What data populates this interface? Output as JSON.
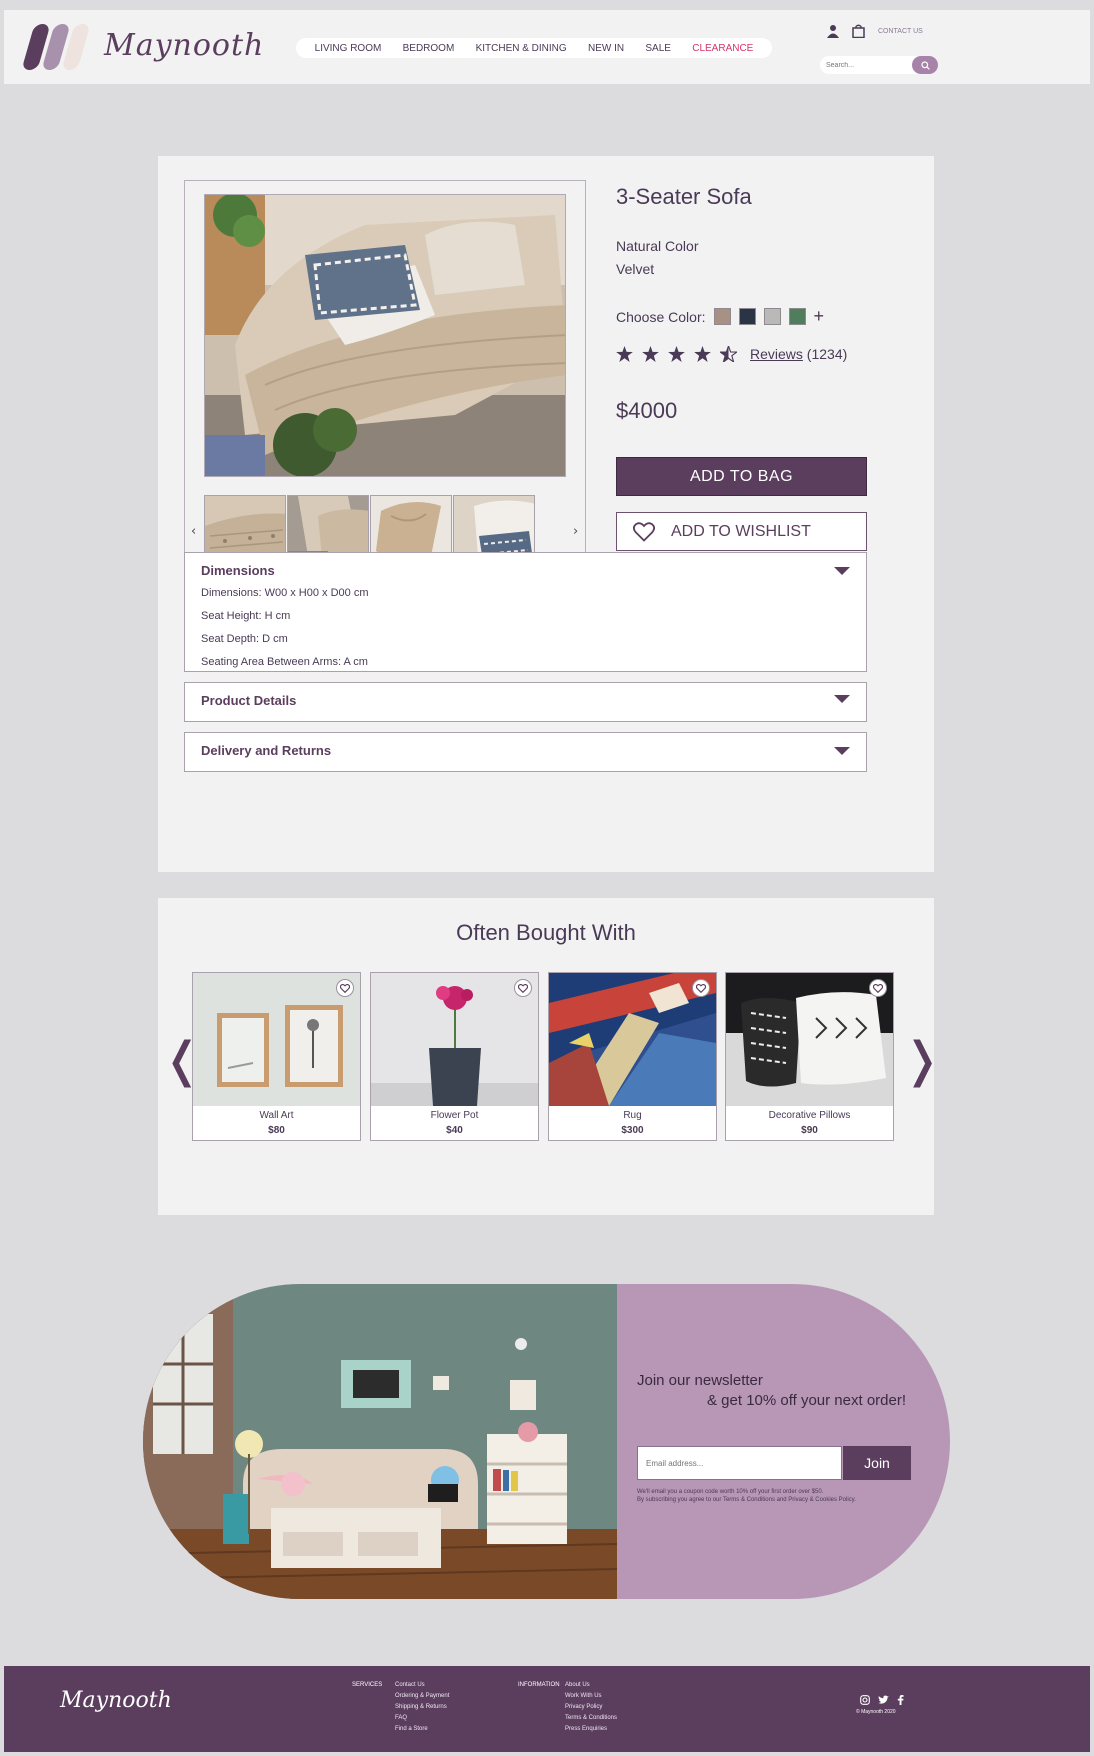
{
  "header": {
    "brand": "Maynooth",
    "nav": [
      "LIVING ROOM",
      "BEDROOM",
      "KITCHEN & DINING",
      "NEW IN",
      "SALE",
      "CLEARANCE"
    ],
    "contact": "CONTACT US",
    "search_placeholder": "Search...",
    "icons": [
      "user-icon",
      "bag-icon",
      "search-icon"
    ]
  },
  "product": {
    "title": "3-Seater Sofa",
    "color_name": "Natural Color",
    "material": "Velvet",
    "choose_color_label": "Choose Color:",
    "swatches": [
      "#a89184",
      "#2b3445",
      "#b9b9b7",
      "#4e7e5c"
    ],
    "more_colors": "+",
    "rating": 4.5,
    "reviews_label": "Reviews",
    "reviews_count": "(1234)",
    "price": "$4000",
    "add_to_bag": "ADD TO BAG",
    "add_to_wishlist": "ADD TO WISHLIST",
    "gallery_prev": "‹",
    "gallery_next": "›"
  },
  "accordion": {
    "dimensions": {
      "title": "Dimensions",
      "lines": [
        "Dimensions: W00 x H00 x D00 cm",
        "Seat Height:  H cm",
        "Seat Depth: D cm",
        "Seating Area Between Arms: A cm"
      ]
    },
    "product_details": {
      "title": "Product Details"
    },
    "delivery": {
      "title": "Delivery and Returns"
    }
  },
  "often_bought": {
    "title": "Often Bought With",
    "prev": "❬",
    "next": "❭",
    "items": [
      {
        "name": "Wall Art",
        "price": "$80"
      },
      {
        "name": "Flower Pot",
        "price": "$40"
      },
      {
        "name": "Rug",
        "price": "$300"
      },
      {
        "name": "Decorative Pillows",
        "price": "$90"
      }
    ]
  },
  "newsletter": {
    "line1": "Join our newsletter",
    "line2": "& get 10% off your next order!",
    "placeholder": "Email address...",
    "join": "Join",
    "fine1": "We'll email you a coupon code worth 10% off your first order over $50.",
    "fine2": "By subscribing you agree to our Terms & Conditions and Privacy & Cookies Policy."
  },
  "footer": {
    "brand": "Maynooth",
    "services_head": "SERVICES",
    "services": [
      "Contact Us",
      "Ordering & Payment",
      "Shipping & Returns",
      "FAQ",
      "Find a Store"
    ],
    "information_head": "INFORMATION",
    "information": [
      "About Us",
      "Work With Us",
      "Privacy Policy",
      "Terms & Conditions",
      "Press Enquiries"
    ],
    "social": [
      "instagram-icon",
      "twitter-icon",
      "facebook-icon"
    ],
    "copyright": "© Maynooth 2020"
  },
  "colors": {
    "brand": "#5b3d5e",
    "accent": "#a783aa",
    "sale": "#d6336c"
  }
}
